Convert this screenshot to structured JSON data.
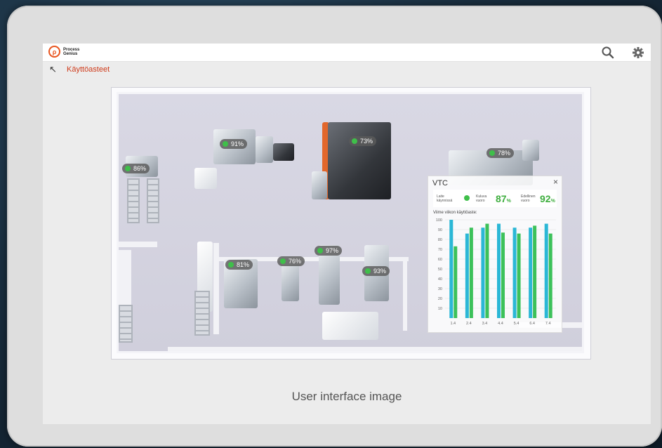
{
  "header": {
    "logo_line1": "Process",
    "logo_line2": "Genius",
    "icons": [
      "search-icon",
      "gear-icon"
    ]
  },
  "subbar": {
    "breadcrumb": "Käyttöasteet"
  },
  "machines": {
    "m1": "86%",
    "m2": "91%",
    "m3": "73%",
    "m4": "78%",
    "m5": "81%",
    "m6": "76%",
    "m7": "97%",
    "m8": "93%"
  },
  "panel": {
    "title": "VTC",
    "close": "×",
    "status_label1": "Laite",
    "status_label2": "käynnissä",
    "current_label1": "Kuluva",
    "current_label2": "vuoro",
    "current_value": "87",
    "previous_label1": "Edellinen",
    "previous_label2": "vuoro",
    "previous_value": "92",
    "unit": "%",
    "chart_title": "Viime viikon käyttöaste:"
  },
  "chart_data": {
    "type": "bar",
    "title": "Viime viikon käyttöaste:",
    "categories": [
      "1.4",
      "2.4",
      "3.4",
      "4.4",
      "5.4",
      "6.4",
      "7.4"
    ],
    "y_ticks": [
      10,
      20,
      30,
      40,
      50,
      60,
      70,
      80,
      90,
      100
    ],
    "ylim": [
      0,
      100
    ],
    "series": [
      {
        "color": "#2bb7d6",
        "values": [
          100,
          86,
          92,
          96,
          92,
          92,
          96
        ]
      },
      {
        "color": "#3cc15a",
        "values": [
          73,
          92,
          96,
          87,
          86,
          94,
          86
        ]
      }
    ],
    "grid": true
  },
  "caption": "User interface image",
  "colors": {
    "accent": "#cf3b1b",
    "status_green": "#3fbf4a",
    "value_green": "#3fae3f"
  }
}
